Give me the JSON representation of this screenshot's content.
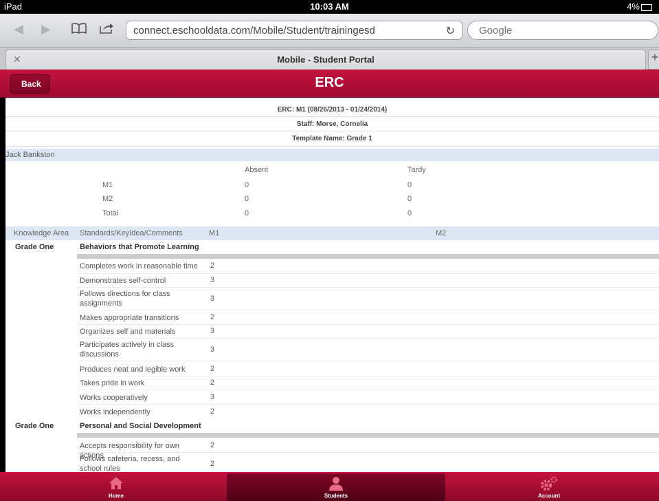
{
  "status": {
    "left": "iPad",
    "time": "10:03 AM",
    "battery": "4%"
  },
  "browser": {
    "url": "connect.eschooldata.com/Mobile/Student/trainingesd",
    "search_placeholder": "Google",
    "tab_title": "Mobile - Student Portal"
  },
  "header": {
    "back_label": "Back",
    "title": "ERC"
  },
  "report": {
    "period": "ERC: M1 (08/26/2013 - 01/24/2014)",
    "staff": "Staff: Morse, Cornelia",
    "template": "Template Name: Grade 1",
    "student": "Jack Bankston"
  },
  "attendance": {
    "col_absent": "Absent",
    "col_tardy": "Tardy",
    "rows": [
      {
        "label": "M1",
        "absent": "0",
        "tardy": "0"
      },
      {
        "label": "M2",
        "absent": "0",
        "tardy": "0"
      },
      {
        "label": "Total",
        "absent": "0",
        "tardy": "0"
      }
    ]
  },
  "grades_header": {
    "knowledge": "Knowledge Area",
    "standards": "Standards/KeyIdea/Comments",
    "m1": "M1",
    "m2": "M2"
  },
  "sections": [
    {
      "grade": "Grade One",
      "category": "Behaviors that Promote Learning",
      "items": [
        {
          "label": "Completes work in reasonable time",
          "m1": "2"
        },
        {
          "label": "Demonstrates self-control",
          "m1": "3"
        },
        {
          "label": "Follows directions for class assignments",
          "m1": "3"
        },
        {
          "label": "Makes appropriate transitions",
          "m1": "2"
        },
        {
          "label": "Organizes self and materials",
          "m1": "3"
        },
        {
          "label": "Participates actively in class discussions",
          "m1": "3"
        },
        {
          "label": "Produces neat and legible work",
          "m1": "2"
        },
        {
          "label": "Takes pride in work",
          "m1": "2"
        },
        {
          "label": "Works cooperatively",
          "m1": "3"
        },
        {
          "label": "Works independently",
          "m1": "2"
        }
      ]
    },
    {
      "grade": "Grade One",
      "category": "Personal and Social Development",
      "items": [
        {
          "label": "Accepts responsibility for own actions",
          "m1": "2"
        },
        {
          "label": "Follows cafeteria, recess, and school rules",
          "m1": "2"
        }
      ]
    }
  ],
  "bottom_nav": [
    {
      "label": "Home",
      "icon": "home-icon"
    },
    {
      "label": "Students",
      "icon": "student-icon"
    },
    {
      "label": "Account",
      "icon": "gear-icon"
    }
  ]
}
